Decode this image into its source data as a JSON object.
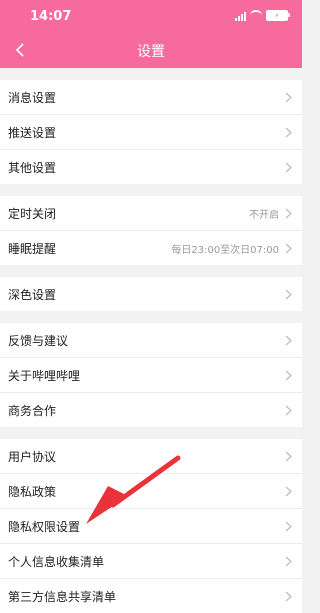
{
  "status": {
    "time": "14:07",
    "battery": "⚡"
  },
  "header": {
    "title": "设置",
    "back_label": "<"
  },
  "groups": [
    {
      "items": [
        {
          "label": "消息设置",
          "value": ""
        },
        {
          "label": "推送设置",
          "value": ""
        },
        {
          "label": "其他设置",
          "value": ""
        }
      ]
    },
    {
      "items": [
        {
          "label": "定时关闭",
          "value": "不开启"
        },
        {
          "label": "睡眠提醒",
          "value": "每日23:00至次日07:00"
        }
      ]
    },
    {
      "items": [
        {
          "label": "深色设置",
          "value": ""
        }
      ]
    },
    {
      "items": [
        {
          "label": "反馈与建议",
          "value": ""
        },
        {
          "label": "关于哔哩哔哩",
          "value": ""
        },
        {
          "label": "商务合作",
          "value": ""
        }
      ]
    },
    {
      "items": [
        {
          "label": "用户协议",
          "value": ""
        },
        {
          "label": "隐私政策",
          "value": ""
        },
        {
          "label": "隐私权限设置",
          "value": ""
        },
        {
          "label": "个人信息收集清单",
          "value": ""
        },
        {
          "label": "第三方信息共享清单",
          "value": ""
        }
      ]
    }
  ],
  "colors": {
    "header_bg": "#f76b9c",
    "annotation_arrow": "#e8333b"
  }
}
